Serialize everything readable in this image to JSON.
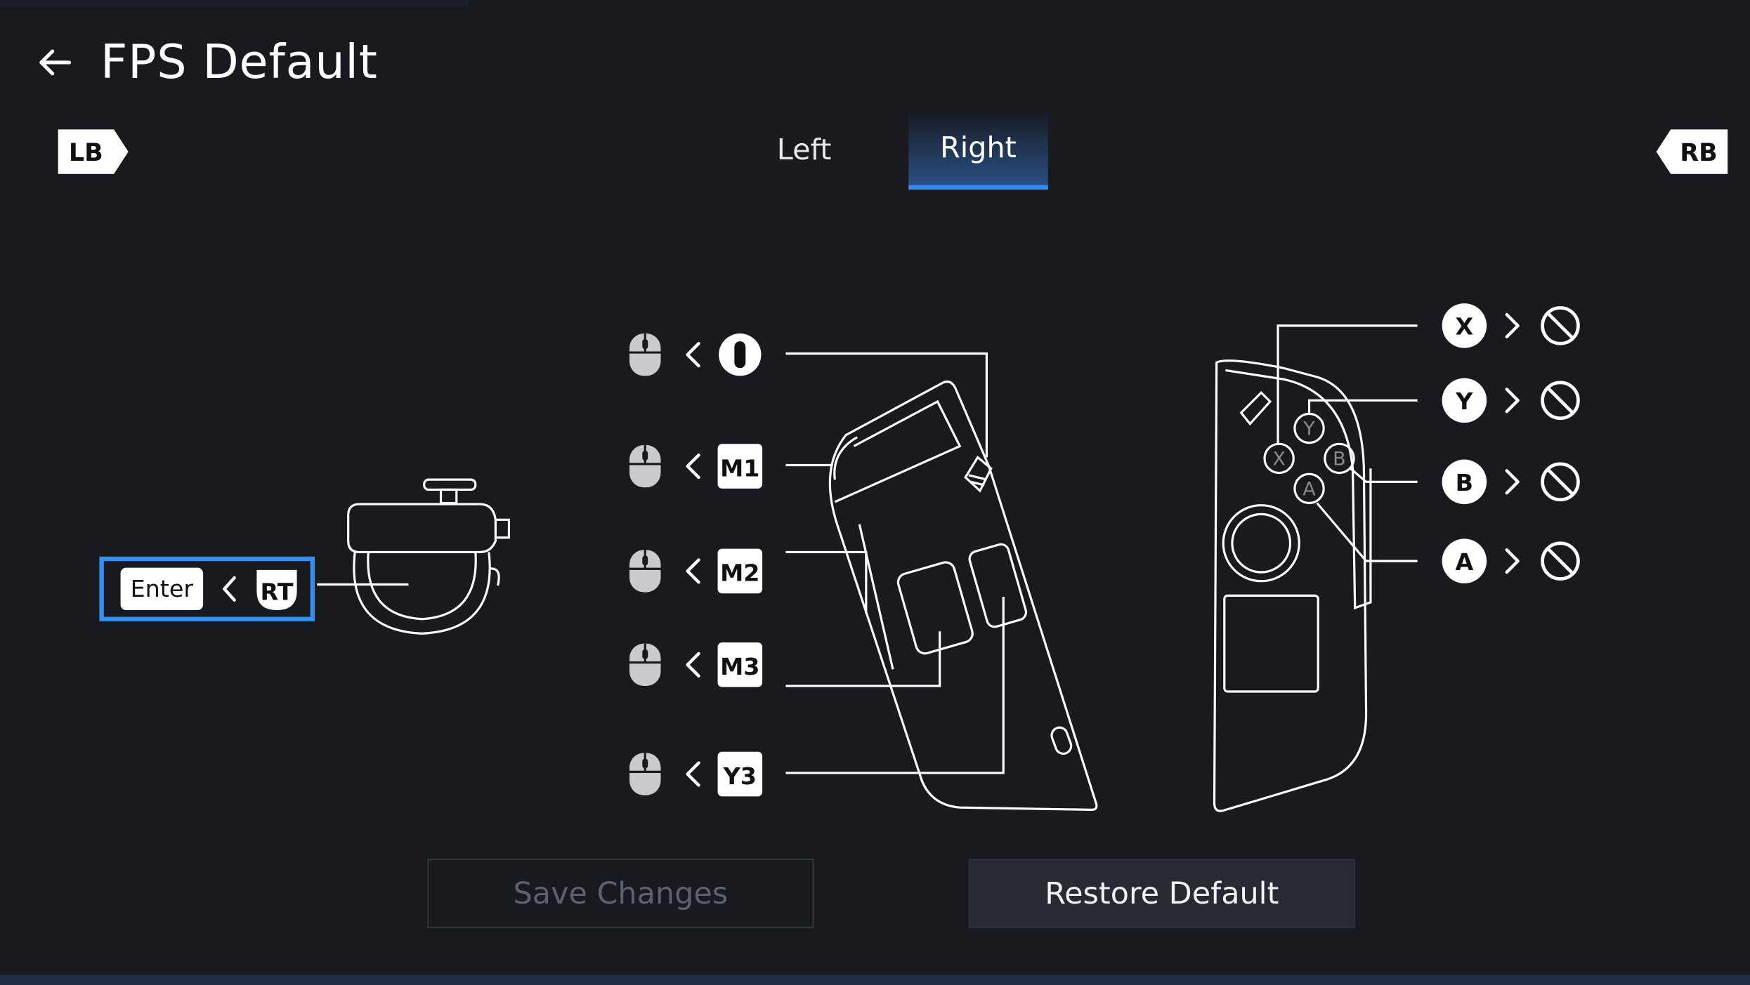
{
  "header": {
    "title": "FPS Default"
  },
  "bumpers": {
    "left": "LB",
    "right": "RB"
  },
  "tabs": [
    {
      "label": "Left",
      "active": false
    },
    {
      "label": "Right",
      "active": true
    }
  ],
  "trigger_mapping": {
    "source": "RT",
    "target": "Enter"
  },
  "side_buttons": [
    {
      "source": "scroll-wheel-icon",
      "target": "mouse-middle-icon"
    },
    {
      "source": "M1",
      "target": "mouse-left-icon"
    },
    {
      "source": "M2",
      "target": "mouse-right-icon"
    },
    {
      "source": "M3",
      "target": "mouse-middle-icon"
    },
    {
      "source": "Y3",
      "target": "mouse-icon"
    }
  ],
  "face_buttons": [
    {
      "source": "X",
      "target": "disabled-icon"
    },
    {
      "source": "Y",
      "target": "disabled-icon"
    },
    {
      "source": "B",
      "target": "disabled-icon"
    },
    {
      "source": "A",
      "target": "disabled-icon"
    }
  ],
  "actions": {
    "save": "Save Changes",
    "restore": "Restore Default"
  },
  "colors": {
    "accent": "#2f8cff",
    "background": "#181a1f",
    "tab_active": "#2a4f84"
  }
}
